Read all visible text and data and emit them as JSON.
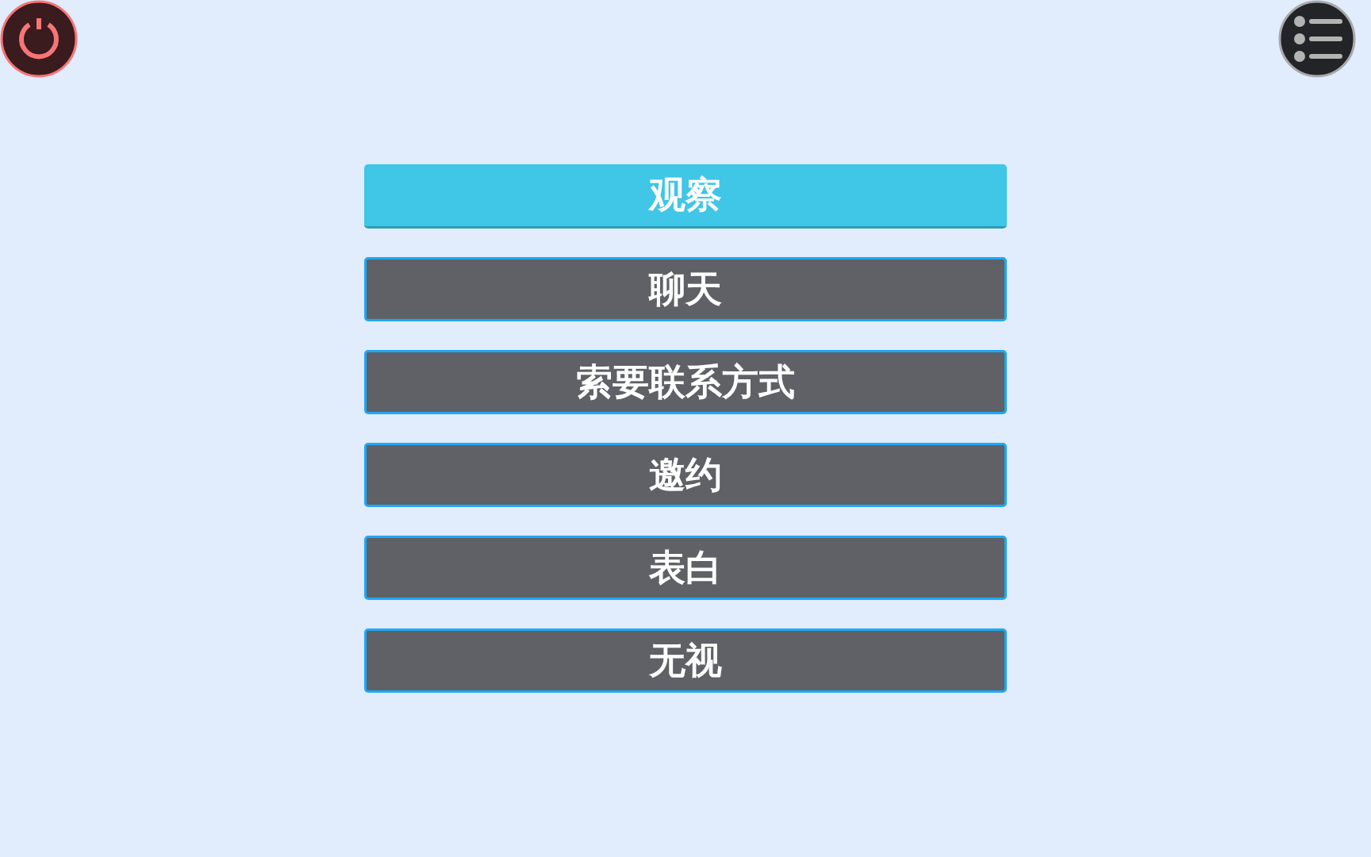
{
  "options": [
    {
      "label": "观察",
      "selected": true
    },
    {
      "label": "聊天",
      "selected": false
    },
    {
      "label": "索要联系方式",
      "selected": false
    },
    {
      "label": "邀约",
      "selected": false
    },
    {
      "label": "表白",
      "selected": false
    },
    {
      "label": "无视",
      "selected": false
    }
  ]
}
